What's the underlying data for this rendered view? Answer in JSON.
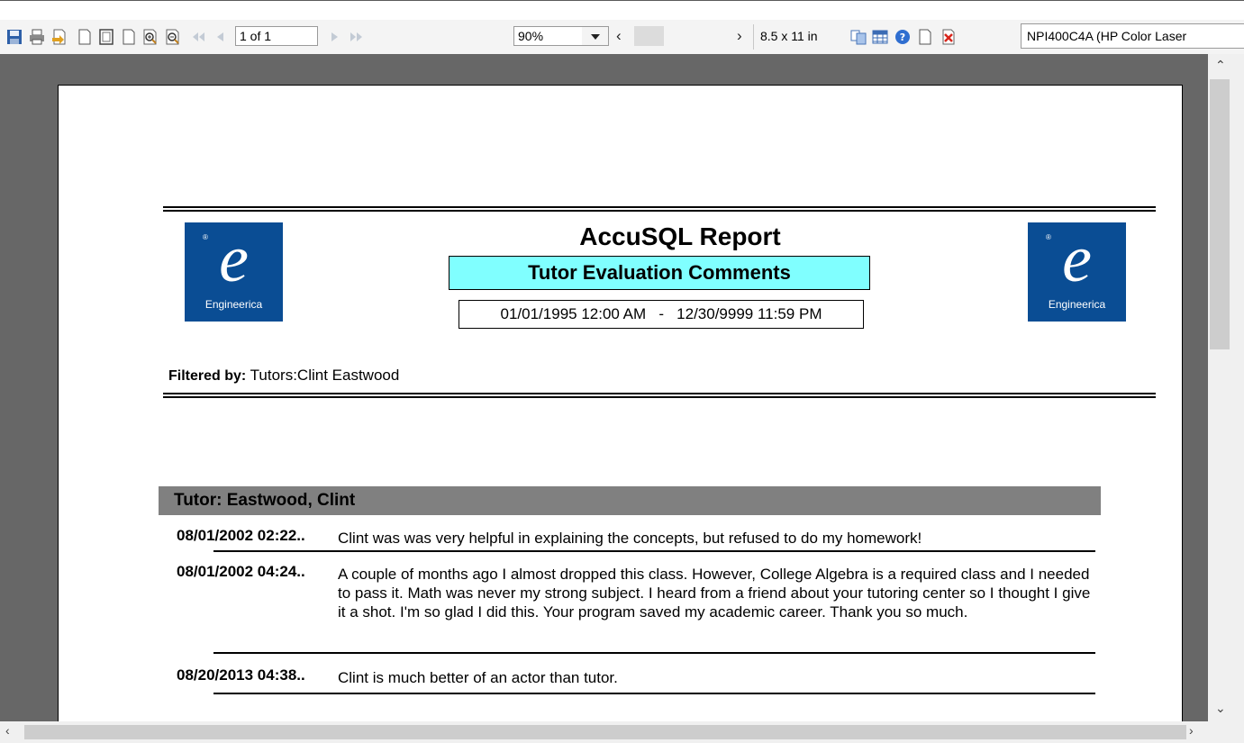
{
  "toolbar": {
    "page_indicator": "1 of 1",
    "zoom": "90%",
    "paper_size": "8.5 x 11 in",
    "printer": "NPI400C4A (HP Color Laser"
  },
  "report": {
    "title": "AccuSQL Report",
    "subtitle": "Tutor Evaluation Comments",
    "date_start": "01/01/1995 12:00 AM",
    "date_separator": "-",
    "date_end": "12/30/9999 11:59 PM",
    "logo_text": "Engineerica",
    "filter_label": "Filtered by:",
    "filter_value": "Tutors:Clint Eastwood",
    "group_header": "Tutor: Eastwood, Clint",
    "comments": [
      {
        "date": "08/01/2002 02:22..",
        "text": "Clint was was very helpful in explaining the concepts, but refused to do my homework!"
      },
      {
        "date": "08/01/2002 04:24..",
        "text": "A couple of months ago I almost dropped this class.  However, College Algebra is a required class and I needed to pass it.  Math was never my strong subject.  I heard from a friend about your tutoring center so I thought I give it a shot.  I'm so glad I did this.  Your program saved my academic career.  Thank you so much."
      },
      {
        "date": "08/20/2013 04:38..",
        "text": "Clint is much better of an actor than tutor."
      }
    ]
  },
  "colors": {
    "logo_bg": "#0a4d94",
    "subtitle_bg": "#80ffff",
    "group_bg": "#808080",
    "viewer_bg": "#676767"
  },
  "icons": [
    "save-icon",
    "print-icon",
    "export-icon",
    "page-icon",
    "page-setup-icon",
    "page-icon",
    "zoom-in-icon",
    "zoom-out-icon",
    "first-page-icon",
    "prev-page-icon",
    "next-page-icon",
    "last-page-icon",
    "chevron-left-icon",
    "chevron-right-icon",
    "thumbnails-icon",
    "grid-icon",
    "help-icon",
    "page-icon",
    "close-icon"
  ]
}
